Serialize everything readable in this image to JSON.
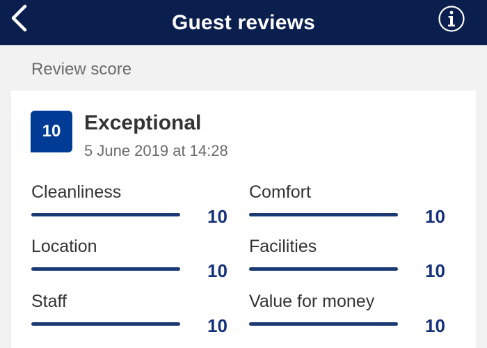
{
  "header": {
    "title": "Guest reviews",
    "back_icon": "chevron-left-icon",
    "info_icon": "info-circle-icon"
  },
  "section": {
    "label": "Review score"
  },
  "review": {
    "score": "10",
    "score_word": "Exceptional",
    "date": "5 June 2019 at 14:28"
  },
  "categories": [
    {
      "label": "Cleanliness",
      "value": "10",
      "fraction": 1.0
    },
    {
      "label": "Comfort",
      "value": "10",
      "fraction": 1.0
    },
    {
      "label": "Location",
      "value": "10",
      "fraction": 1.0
    },
    {
      "label": "Facilities",
      "value": "10",
      "fraction": 1.0
    },
    {
      "label": "Staff",
      "value": "10",
      "fraction": 1.0
    },
    {
      "label": "Value for money",
      "value": "10",
      "fraction": 1.0
    }
  ],
  "colors": {
    "header_bg": "#0b1f4f",
    "badge_bg": "#003b95",
    "bar_fill": "#1b3a73",
    "value_text": "#14307a"
  }
}
